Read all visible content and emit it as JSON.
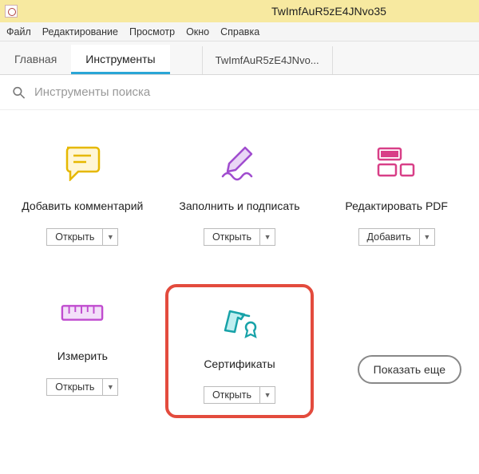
{
  "window": {
    "title": "TwImfAuR5zE4JNvo35"
  },
  "menu": {
    "file": "Файл",
    "edit": "Редактирование",
    "view": "Просмотр",
    "window": "Окно",
    "help": "Справка"
  },
  "tabs": {
    "home": "Главная",
    "tools": "Инструменты",
    "document": "TwImfAuR5zE4JNvo..."
  },
  "search": {
    "placeholder": "Инструменты поиска"
  },
  "buttons": {
    "open": "Открыть",
    "add": "Добавить",
    "show_more": "Показать еще"
  },
  "tools": {
    "comment": "Добавить комментарий",
    "fill_sign": "Заполнить и подписать",
    "edit_pdf": "Редактировать PDF",
    "measure": "Измерить",
    "certificates": "Сертификаты"
  }
}
